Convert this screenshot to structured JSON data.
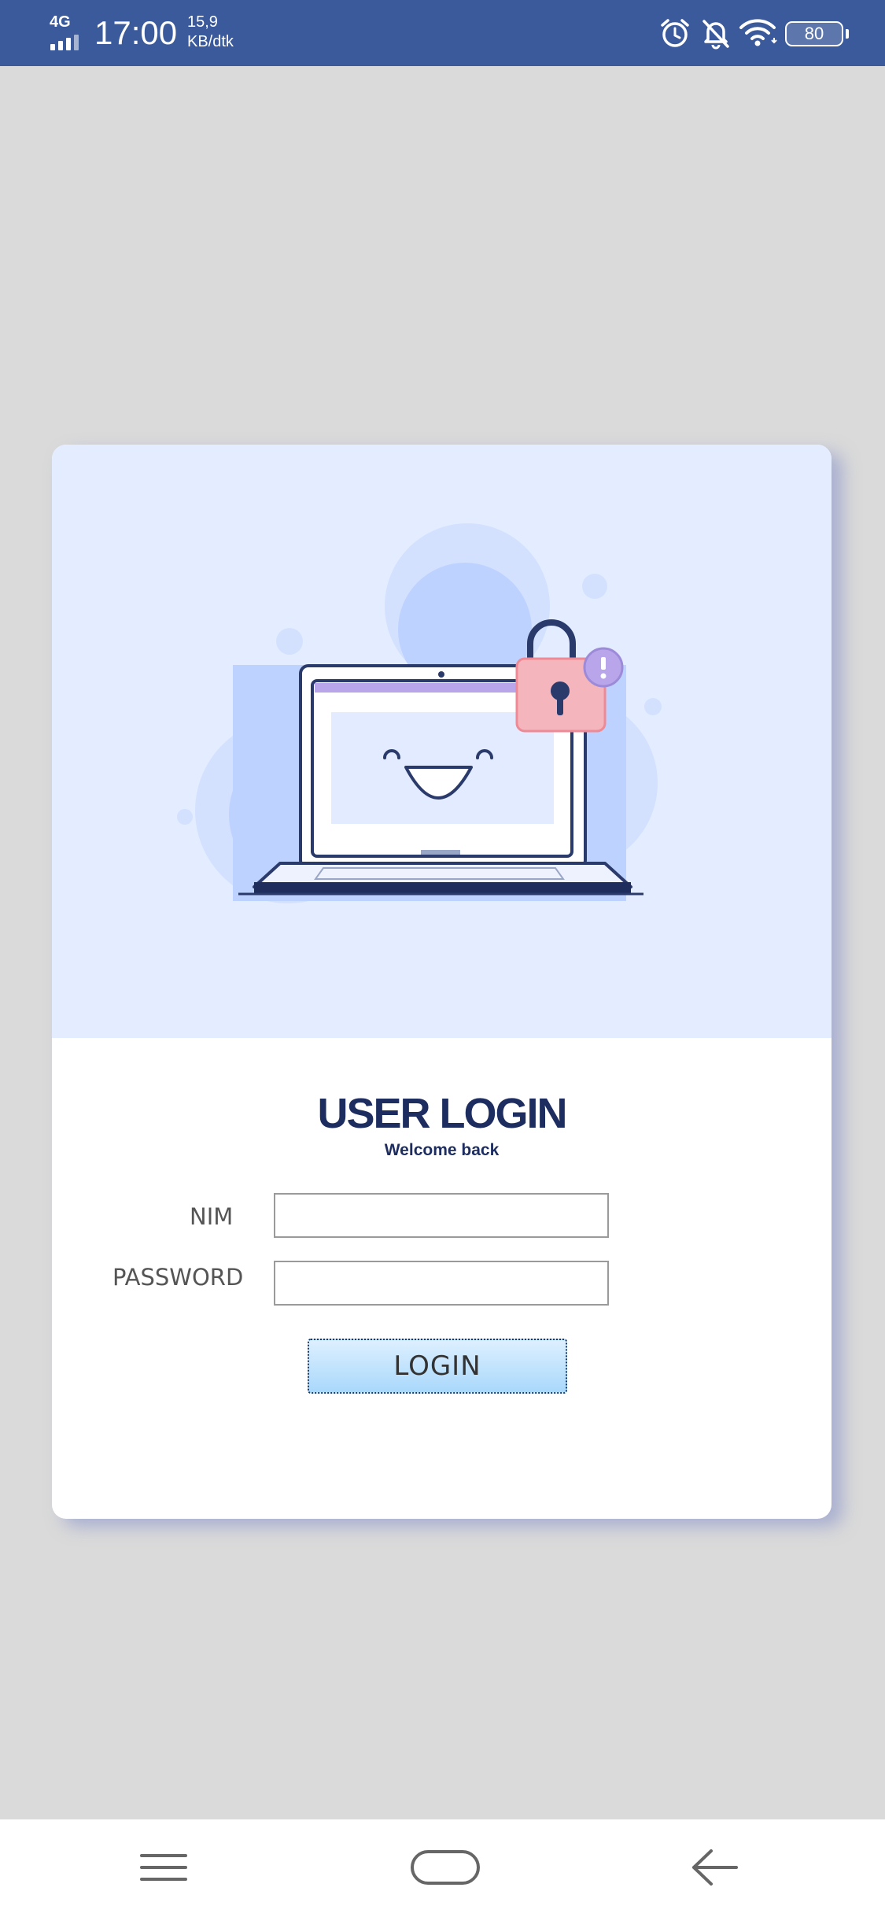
{
  "status_bar": {
    "network_type": "4G",
    "time": "17:00",
    "speed_value": "15,9",
    "speed_unit": "KB/dtk",
    "battery": "80",
    "icons": [
      "signal-icon",
      "alarm-icon",
      "bell-off-icon",
      "wifi-icon",
      "battery-icon"
    ]
  },
  "login_card": {
    "illustration": "laptop-lock-illustration",
    "title": "USER LOGIN",
    "subtitle": "Welcome back",
    "fields": [
      {
        "label": "NIM",
        "value": "",
        "placeholder": ""
      },
      {
        "label": "PASSWORD",
        "value": "",
        "placeholder": ""
      }
    ],
    "login_button": "LOGIN"
  },
  "nav_bar": {
    "buttons": [
      "menu-icon",
      "home-icon",
      "back-icon"
    ]
  },
  "colors": {
    "status_bar": "#3a5a9c",
    "page_background": "#dadada",
    "hero_background": "#e4edff",
    "title": "#1d2d5f",
    "button_gradient_top": "#ddf0ff",
    "button_gradient_bottom": "#a9d8fb"
  }
}
